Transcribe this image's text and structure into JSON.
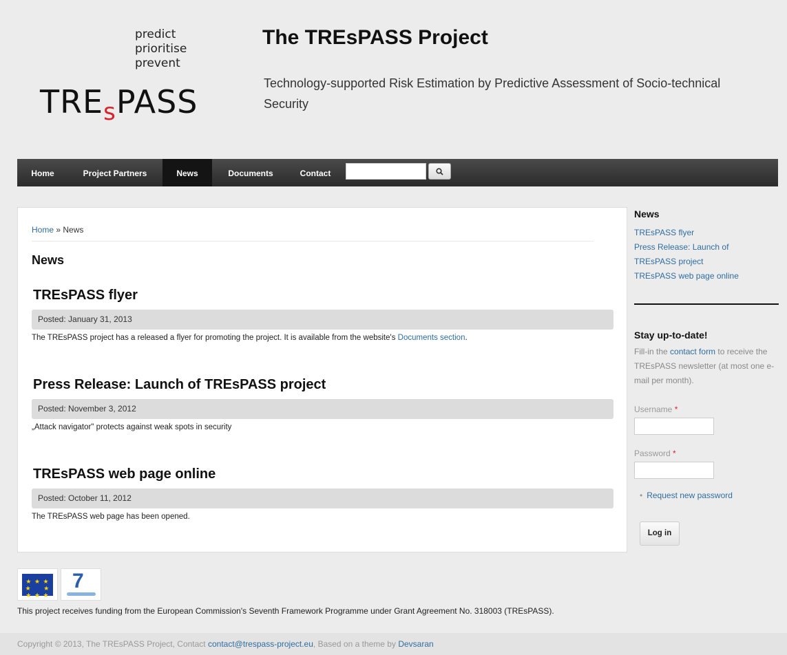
{
  "header": {
    "tagline": [
      "predict",
      "prioritise",
      "prevent"
    ],
    "logo_text_pre": "TRE",
    "logo_text_s": "s",
    "logo_text_post": "PASS",
    "site_name": "The TREsPASS Project",
    "slogan": "Technology-supported Risk Estimation by Predictive Assessment of Socio-technical Security"
  },
  "nav": {
    "items": [
      {
        "label": "Home"
      },
      {
        "label": "Project Partners"
      },
      {
        "label": "News"
      },
      {
        "label": "Documents"
      },
      {
        "label": "Contact"
      }
    ],
    "active": "News",
    "search_value": "",
    "search_button_icon": "search-icon"
  },
  "main": {
    "breadcrumb_home": "Home",
    "breadcrumb_sep": "»",
    "breadcrumb_current": "News",
    "page_title": "News",
    "nodes": [
      {
        "title": "TREsPASS flyer",
        "posted": "Posted: January 31, 2013",
        "body_text": "The TREsPASS project has a released a flyer for promoting the project. It is available from the website's",
        "body_link": "Documents section",
        "body_tail": "."
      },
      {
        "title": "Press Release: Launch of TREsPASS project",
        "posted": "Posted: November 3, 2012",
        "body_text": "„Attack navigator\" protects against weak spots in security",
        "body_link": "",
        "body_tail": ""
      },
      {
        "title": "TREsPASS web page online",
        "posted": "Posted: October 11, 2012",
        "body_text": "The TREsPASS web page has been opened.",
        "body_link": "",
        "body_tail": ""
      }
    ]
  },
  "sidebar": {
    "news_title": "News",
    "news_links": [
      "TREsPASS flyer",
      "Press Release: Launch of",
      "TREsPASS project",
      "TREsPASS web page online"
    ],
    "stay_title": "Stay up-to-date!",
    "stay_text_pre": "Fill-in the",
    "stay_link": "contact form",
    "stay_text_post": "to receive the TREsPASS newsletter (at most one e-mail per month).",
    "username_label": "Username",
    "password_label": "Password",
    "required_marker": "*",
    "request_password": "Request new password",
    "login_button": "Log in"
  },
  "footer": {
    "funding": "This project receives funding from the European Commission's Seventh Framework Programme under Grant Agreement No. 318003 (TREsPASS).",
    "copyright_pre": "Copyright © 2013, The TREsPASS Project, Contact",
    "contact_email": "contact@trespass-project.eu",
    "copyright_mid": ", Based on a theme by",
    "theme_author": "Devsaran",
    "fp7_mark": "7"
  },
  "colors": {
    "link": "#2f6d9f",
    "logo_accent": "#d9222a",
    "nav_bg": "#2b2b2b",
    "nav_active": "#141414",
    "eu_blue": "#1b3f9e"
  }
}
